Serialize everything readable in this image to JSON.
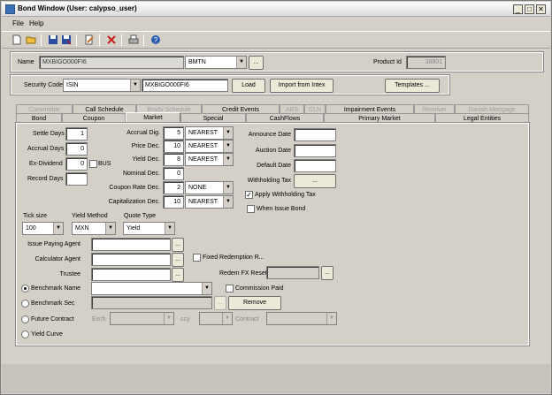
{
  "window": {
    "title": "Bond Window (User: calypso_user)",
    "min": "_",
    "max": "□",
    "close": "✕"
  },
  "menu": [
    "File",
    "Help"
  ],
  "toolbar": [
    "new-icon",
    "open-icon",
    "save-icon",
    "save-as-icon",
    "edit-icon",
    "delete-icon",
    "print-icon",
    "help-icon"
  ],
  "name_row": {
    "name_label": "Name",
    "name_value": "MXBIGO000FI6",
    "type_value": "BMTN",
    "ellipsis": "...",
    "product_id_label": "Product Id",
    "product_id_value": "38801"
  },
  "security_row": {
    "label": "Security Code",
    "code_type": "ISIN",
    "code_value": "MXBIGO000FI6",
    "load": "Load",
    "import": "Import from Intex",
    "templates": "Templates ..."
  },
  "tabs_row1": [
    {
      "label": "Convertible",
      "disabled": true
    },
    {
      "label": "Call Schedule",
      "disabled": false
    },
    {
      "label": "Brady Schedule",
      "disabled": true
    },
    {
      "label": "Credit Events",
      "disabled": false
    },
    {
      "label": "ABS",
      "disabled": true
    },
    {
      "label": "CLN",
      "disabled": true
    },
    {
      "label": "Impairment Events",
      "disabled": false
    },
    {
      "label": "Revolver",
      "disabled": true
    },
    {
      "label": "Danish Mortgage",
      "disabled": true
    }
  ],
  "tabs_row2": [
    "Bond",
    "Coupon",
    "Market",
    "Special",
    "CashFlows",
    "Primary Market",
    "Legal Entities"
  ],
  "market": {
    "settle_days_label": "Settle Days",
    "settle_days": "1",
    "accrual_days_label": "Accrual Days",
    "accrual_days": "0",
    "ex_dividend_label": "Ex-Dividend",
    "ex_dividend": "0",
    "bus_label": "BUS",
    "record_days_label": "Record Days",
    "record_days": "",
    "accrual_dig_label": "Accrual Dig.",
    "accrual_dig": "5",
    "accrual_dig_round": "NEAREST",
    "price_dec_label": "Price Dec.",
    "price_dec": "10",
    "price_dec_round": "NEAREST",
    "yield_dec_label": "Yield Dec.",
    "yield_dec": "8",
    "yield_dec_round": "NEAREST",
    "nominal_dec_label": "Nominal Dec.",
    "nominal_dec": "0",
    "coupon_rate_dec_label": "Coupon Rate Dec.",
    "coupon_rate_dec": "2",
    "coupon_rate_dec_round": "NONE",
    "cap_dec_label": "Capitalization Dec.",
    "cap_dec": "10",
    "cap_dec_round": "NEAREST",
    "announce_date_label": "Announce Date",
    "auction_date_label": "Auction Date",
    "default_date_label": "Default Date",
    "withholding_tax_label": "Withholding Tax",
    "withholding_btn": "...",
    "apply_withholding_label": "Apply Withholding Tax",
    "when_issue_label": "When Issue Bond",
    "tick_size_label": "Tick size",
    "tick_size": "100",
    "yield_method_label": "Yield Method",
    "yield_method": "MXN",
    "quote_type_label": "Quote Type",
    "quote_type": "Yield",
    "issue_paying_agent_label": "Issue Paying Agent",
    "calculator_agent_label": "Calculator Agent",
    "trustee_label": "Trustee",
    "fixed_redemption_label": "Fixed Redemption R...",
    "redem_fx_reset_label": "Redem FX Reset",
    "benchmark_name_label": "Benchmark Name",
    "commission_paid_label": "Commission Paid",
    "benchmark_sec_label": "Benchmark Sec",
    "remove_btn": "Remove",
    "future_contract_label": "Future Contract",
    "exch_label": "Exch",
    "ccy_label": "ccy",
    "contract_label": "Contract",
    "yield_curve_label": "Yield Curve"
  }
}
